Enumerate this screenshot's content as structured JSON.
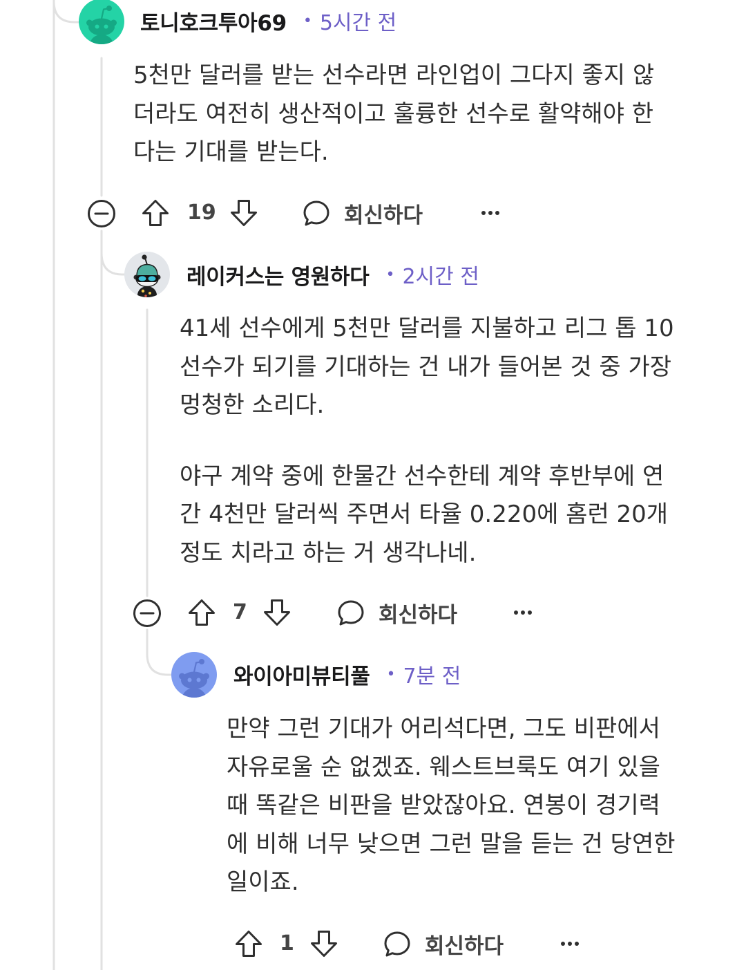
{
  "colors": {
    "background": "#ffffff",
    "text": "#2f2f2f",
    "username": "#1a1a1b",
    "timestamp": "#6d5fc7",
    "action_text": "#444444",
    "icon": "#2f2f2f",
    "thread_line": "#e1e1e1"
  },
  "comments": [
    {
      "username": "토니호크투아69",
      "separator": "•",
      "time": "5시간 전",
      "avatar": {
        "icon": "snoo-avatar-icon",
        "background": "#24d3a6",
        "foreground": "#15a984"
      },
      "body": [
        [
          "5천만 달러를 받는 선수라면 라인업이 그다지 좋지 않",
          "더라도 여전히 생산적이고 훌륭한 선수로 활약해야 한",
          "다는 기대를 받는다."
        ]
      ],
      "score": "19",
      "reply_label": "회신하다",
      "icons": [
        "collapse-icon",
        "upvote-icon",
        "downvote-icon",
        "comment-icon",
        "more-icon"
      ]
    },
    {
      "username": "레이커스는 영원하다",
      "separator": "•",
      "time": "2시간 전",
      "avatar": {
        "icon": "custom-snoo-avatar-icon",
        "background": "#e3e6ea"
      },
      "body": [
        [
          "41세 선수에게 5천만 달러를 지불하고 리그 톱 10",
          "선수가 되기를 기대하는 건 내가 들어본 것 중 가장",
          "멍청한 소리다."
        ],
        [
          "야구 계약 중에 한물간 선수한테 계약 후반부에 연",
          "간 4천만 달러씩 주면서 타율 0.220에 홈런 20개",
          "정도 치라고 하는 거 생각나네."
        ]
      ],
      "score": "7",
      "reply_label": "회신하다",
      "icons": [
        "collapse-icon",
        "upvote-icon",
        "downvote-icon",
        "comment-icon",
        "more-icon"
      ]
    },
    {
      "username": "와이아미뷰티풀",
      "separator": "•",
      "time": "7분 전",
      "avatar": {
        "icon": "snoo-avatar-icon",
        "background": "#7f9cf0",
        "foreground": "#5d78d1"
      },
      "body": [
        [
          "만약 그런 기대가 어리석다면, 그도 비판에서",
          "자유로울 순 없겠죠. 웨스트브룩도 여기 있을",
          "때 똑같은 비판을 받았잖아요. 연봉이 경기력",
          "에 비해 너무 낮으면 그런 말을 듣는 건 당연한",
          "일이죠."
        ]
      ],
      "score": "1",
      "reply_label": "회신하다",
      "icons": [
        "upvote-icon",
        "downvote-icon",
        "comment-icon",
        "more-icon"
      ]
    }
  ]
}
